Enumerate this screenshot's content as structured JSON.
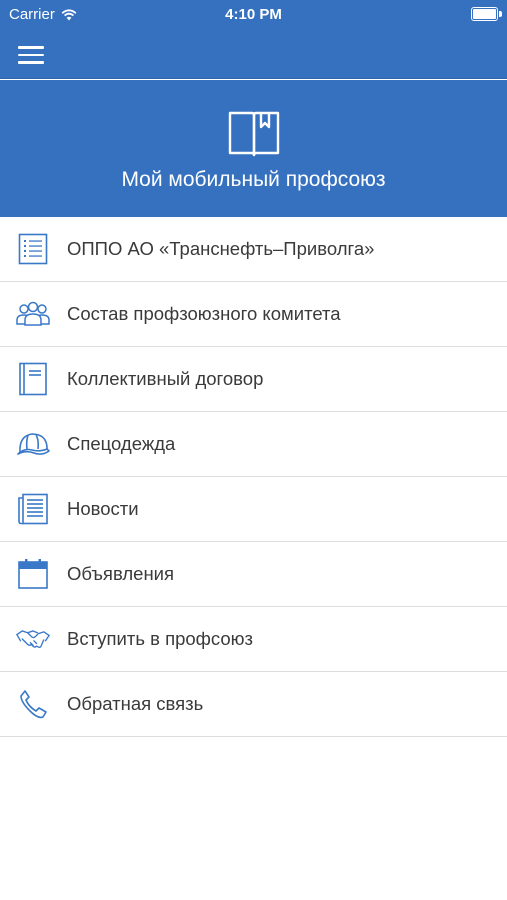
{
  "status_bar": {
    "carrier": "Carrier",
    "time": "4:10 PM"
  },
  "header": {
    "menu_icon": "hamburger-icon",
    "title": "Мой мобильный профсоюз",
    "logo_icon": "open-book-icon"
  },
  "colors": {
    "primary": "#3571bf",
    "icon": "#3a78c8",
    "text": "#3a3a3a",
    "divider": "#dddddd"
  },
  "menu": [
    {
      "label": "ОППО АО «Транснефть–Приволга»",
      "icon": "list-document-icon"
    },
    {
      "label": "Состав профзоюзного комитета",
      "icon": "people-group-icon"
    },
    {
      "label": "Коллективный договор",
      "icon": "book-icon"
    },
    {
      "label": "Спецодежда",
      "icon": "hard-hat-icon"
    },
    {
      "label": "Новости",
      "icon": "newspaper-icon"
    },
    {
      "label": "Объявления",
      "icon": "calendar-icon"
    },
    {
      "label": "Вступить в профсоюз",
      "icon": "handshake-icon"
    },
    {
      "label": "Обратная связь",
      "icon": "phone-icon"
    }
  ]
}
